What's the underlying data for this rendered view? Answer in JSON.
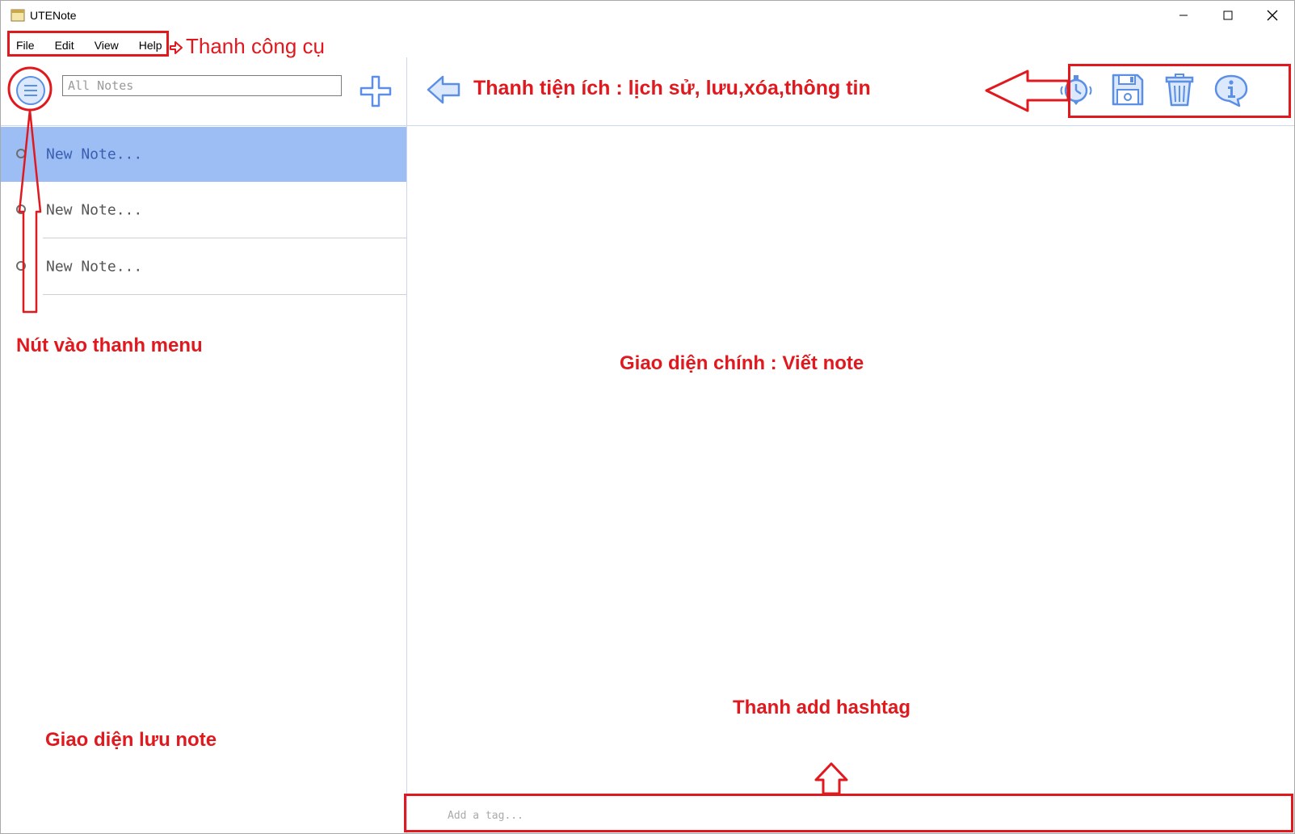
{
  "window": {
    "title": "UTENote",
    "controls": [
      "minimize-icon",
      "maximize-icon",
      "close-icon"
    ]
  },
  "menubar": {
    "items": [
      {
        "label": "File"
      },
      {
        "label": "Edit"
      },
      {
        "label": "View"
      },
      {
        "label": "Help"
      }
    ]
  },
  "sidebar": {
    "search_placeholder": "All Notes",
    "notes": [
      {
        "label": "New Note...",
        "selected": true
      },
      {
        "label": "New Note...",
        "selected": false
      },
      {
        "label": "New Note...",
        "selected": false
      }
    ]
  },
  "toolbar": {
    "icons": [
      "history-icon",
      "save-icon",
      "trash-icon",
      "info-icon"
    ]
  },
  "tagbar": {
    "placeholder": "Add a tag..."
  },
  "annotations": {
    "toolbar_menu": "Thanh công cụ",
    "menu_button": "Nút vào thanh menu",
    "note_list": "Giao diện lưu note",
    "utility_bar": "Thanh tiện ích : lịch sử, lưu,xóa,thông tin",
    "main_editor": "Giao diện chính : Viết note",
    "hashtag_bar": "Thanh add hashtag"
  },
  "colors": {
    "accent": "#9dbdf5",
    "icon_blue": "#5b8fe6",
    "annotation_red": "#e0191f"
  }
}
